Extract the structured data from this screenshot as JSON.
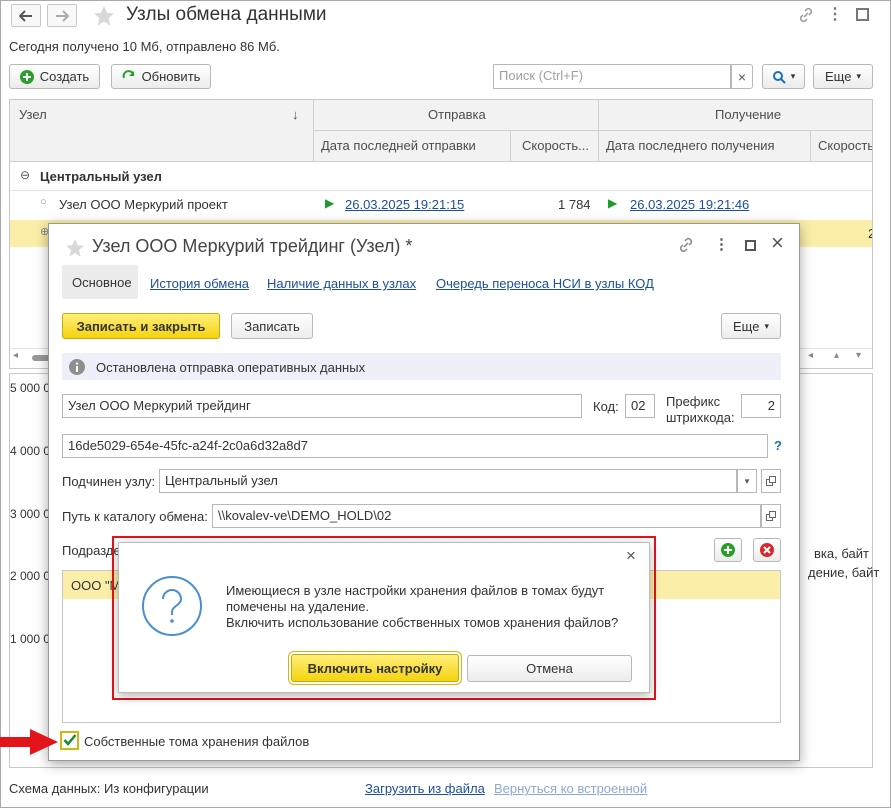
{
  "window": {
    "title": "Узлы обмена данными",
    "info": "Сегодня получено 10 Мб, отправлено 86 Мб."
  },
  "toolbar": {
    "create_label": "Создать",
    "refresh_label": "Обновить",
    "search_placeholder": "Поиск (Ctrl+F)",
    "clear_glyph": "×",
    "more_label": "Еще",
    "dropdown_glyph": "▾"
  },
  "table": {
    "col_node": "Узел",
    "sort_glyph": "↓",
    "group_send": "Отправка",
    "group_recv": "Получение",
    "col_last_send": "Дата последней отправки",
    "col_send_speed": "Скорость...",
    "col_last_recv": "Дата последнего получения",
    "col_recv_speed": "Скорость",
    "group_row": "Центральный узел",
    "row1": {
      "name": "Узел ООО Меркурий проект",
      "send_date": "26.03.2025 19:21:15",
      "send_speed": "1 784",
      "recv_date": "26.03.2025 19:21:46"
    },
    "row2_fragment": "2"
  },
  "bg_chart": {
    "y_ticks": [
      "5 000 0",
      "4 000 0",
      "3 000 0",
      "2 000 0",
      "1 000 0"
    ],
    "right_labels": [
      "вка, байт",
      "дение, байт"
    ]
  },
  "footer": {
    "schema_label": "Схема данных:",
    "schema_value": "Из конфигурации",
    "load_link": "Загрузить из файла",
    "revert_link": "Вернуться ко встроенной"
  },
  "form": {
    "title": "Узел ООО Меркурий трейдинг (Узел) *",
    "tabs": [
      "Основное",
      "История обмена",
      "Наличие данных в узлах",
      "Очередь переноса НСИ в узлы КОД"
    ],
    "save_close_label": "Записать и закрыть",
    "save_label": "Записать",
    "more_label": "Еще",
    "info_text": "Остановлена отправка оперативных данных",
    "name_value": "Узел ООО Меркурий трейдинг",
    "code_label": "Код:",
    "code_value": "02",
    "prefix_label_1": "Префикс",
    "prefix_label_2": "штрихкода:",
    "prefix_value": "2",
    "guid_value": "16de5029-654e-45fc-a24f-2c0a6d32a8d7",
    "help_glyph": "?",
    "parent_label": "Подчинен узлу:",
    "parent_value": "Центральный узел",
    "path_label": "Путь к каталогу обмена:",
    "path_value": "\\\\kovalev-ve\\DEMO_HOLD\\02",
    "subdiv_label_fragment": "Подразде",
    "list_item_fragment": "ООО \"М",
    "checkbox_label": "Собственные тома хранения файлов",
    "checkbox_checked": true
  },
  "dialog": {
    "line1": "Имеющиеся в узле настройки хранения файлов в томах будут",
    "line2": "помечены на удаление.",
    "line3": "Включить использование собственных томов хранения файлов?",
    "confirm_label": "Включить настройку",
    "cancel_label": "Отмена",
    "close_glyph": "×"
  },
  "colors": {
    "accent_yellow": "#f4d30f",
    "selected_row": "#fbeea8",
    "highlight_red": "#e3141a",
    "link_blue": "#1c4fa1",
    "arrow_green": "#1b9b2b"
  }
}
